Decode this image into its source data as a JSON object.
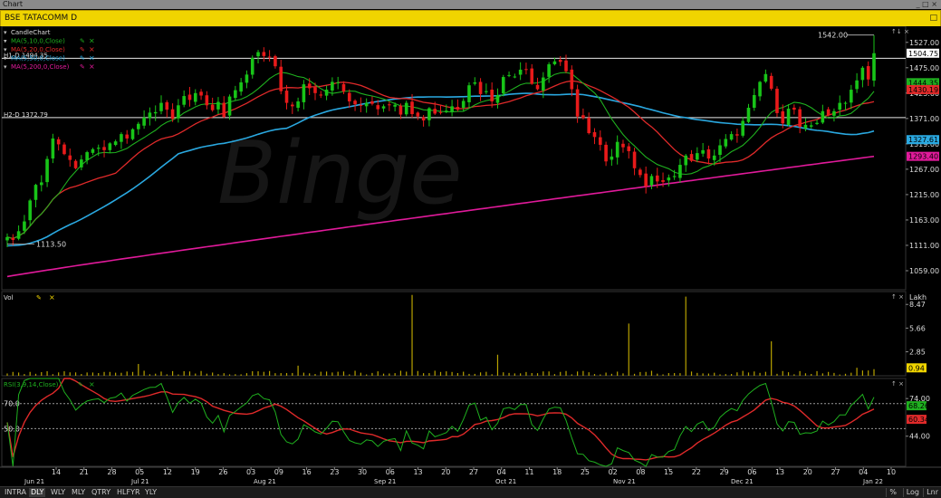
{
  "window_title": "Chart",
  "window_controls": "_ □ ×",
  "chart_title": "BSE TATACOMM D",
  "chart_controls": "□",
  "watermark": "Binge",
  "price_panel": {
    "legend": [
      {
        "label": "CandleChart",
        "color": "#dddddd"
      },
      {
        "label": "MA(5,10,0,Close)",
        "color": "#1fb01f"
      },
      {
        "label": "MA(5,20,0,Close)",
        "color": "#e02a2a"
      },
      {
        "label": "MA(5,50,0,Close)",
        "color": "#2aa8e0"
      },
      {
        "label": "MA(5,200,0,Close)",
        "color": "#e01a9a"
      }
    ],
    "h1_label": "H1-D 1494.35",
    "h2_label": "H2-D 1372.79",
    "high_label": "1542.00",
    "low_label": "1113.50",
    "y_ticks": [
      "1527.00",
      "1475.00",
      "1423.00",
      "1371.00",
      "1319.00",
      "1267.00",
      "1215.00",
      "1163.00",
      "1111.00",
      "1059.00"
    ],
    "value_tags": [
      {
        "text": "1504.75",
        "value": 1504.75,
        "bg": "#ffffff",
        "fg": "#000000"
      },
      {
        "text": "1444.35",
        "value": 1444.35,
        "bg": "#1fb01f",
        "fg": "#000000"
      },
      {
        "text": "1430.19",
        "value": 1430.19,
        "bg": "#e02a2a",
        "fg": "#000000"
      },
      {
        "text": "1327.61",
        "value": 1327.61,
        "bg": "#2aa8e0",
        "fg": "#000000"
      },
      {
        "text": "1293.40",
        "value": 1293.4,
        "bg": "#e01a9a",
        "fg": "#000000"
      }
    ],
    "axis_controls": "↑↓ ×"
  },
  "vol_panel": {
    "label": "Vol",
    "unit": "Lakh",
    "y_ticks": [
      "8.47",
      "5.66",
      "2.85"
    ],
    "value_tag": "0.94",
    "axis_controls": "↑ ×"
  },
  "rsi_panel": {
    "label": "RSI(3,9,14,Close)",
    "level_70": "70.0",
    "level_50": "50.0",
    "y_ticks": [
      "74.00",
      "44.00"
    ],
    "value_tags": [
      {
        "text": "68.26",
        "bg": "#1fb01f"
      },
      {
        "text": "60.34",
        "bg": "#e02a2a"
      }
    ],
    "axis_controls": "↑ ×"
  },
  "x_axis": {
    "ticks": [
      "14",
      "21",
      "28",
      "05",
      "12",
      "19",
      "26",
      "03",
      "09",
      "16",
      "23",
      "30",
      "06",
      "13",
      "20",
      "27",
      "04",
      "11",
      "18",
      "25",
      "02",
      "08",
      "15",
      "22",
      "29",
      "06",
      "13",
      "20",
      "27",
      "04",
      "10"
    ],
    "months": [
      "Jun 21",
      "Jul 21",
      "Aug 21",
      "Sep 21",
      "Oct 21",
      "Nov 21",
      "Dec 21",
      "Jan 22"
    ]
  },
  "bottom_bar": {
    "timeframes": [
      "INTRA",
      "DLY",
      "WLY",
      "MLY",
      "QTRY",
      "HLFYR",
      "YLY"
    ],
    "active": "DLY",
    "right_buttons": [
      "%",
      "Log",
      "Lnr"
    ]
  },
  "chart_data": {
    "type": "candlestick",
    "closes": [
      1128,
      1122,
      1140,
      1160,
      1203,
      1235,
      1240,
      1288,
      1330,
      1318,
      1298,
      1286,
      1269,
      1287,
      1302,
      1308,
      1311,
      1306,
      1320,
      1324,
      1339,
      1330,
      1349,
      1360,
      1373,
      1383,
      1384,
      1403,
      1389,
      1370,
      1398,
      1417,
      1409,
      1423,
      1418,
      1398,
      1388,
      1405,
      1374,
      1416,
      1429,
      1445,
      1461,
      1495,
      1507,
      1499,
      1497,
      1478,
      1427,
      1403,
      1396,
      1406,
      1441,
      1433,
      1423,
      1418,
      1430,
      1446,
      1445,
      1426,
      1406,
      1400,
      1397,
      1403,
      1401,
      1390,
      1396,
      1398,
      1399,
      1379,
      1403,
      1380,
      1375,
      1367,
      1392,
      1381,
      1384,
      1387,
      1396,
      1389,
      1407,
      1439,
      1445,
      1421,
      1427,
      1406,
      1419,
      1456,
      1460,
      1457,
      1471,
      1471,
      1442,
      1431,
      1455,
      1482,
      1488,
      1487,
      1468,
      1431,
      1375,
      1372,
      1341,
      1333,
      1317,
      1283,
      1293,
      1323,
      1312,
      1304,
      1269,
      1255,
      1232,
      1253,
      1242,
      1241,
      1250,
      1253,
      1276,
      1295,
      1284,
      1300,
      1306,
      1289,
      1295,
      1316,
      1329,
      1339,
      1336,
      1366,
      1393,
      1419,
      1446,
      1462,
      1432,
      1382,
      1361,
      1391,
      1389,
      1354,
      1358,
      1357,
      1362,
      1386,
      1378,
      1386,
      1403,
      1403,
      1430,
      1449,
      1475,
      1451,
      1504.75
    ],
    "ma10_last": 1444.35,
    "ma20_last": 1430.19,
    "ma50_last": 1327.61,
    "ma200_last": 1293.4,
    "h1": 1494.35,
    "h2": 1372.79,
    "vol_last": 0.94,
    "rsi_last": 68.26,
    "rsi_signal_last": 60.34,
    "vol_range": [
      0,
      10
    ],
    "rsi_range": [
      20,
      90
    ],
    "price_range": [
      1020,
      1560
    ]
  }
}
